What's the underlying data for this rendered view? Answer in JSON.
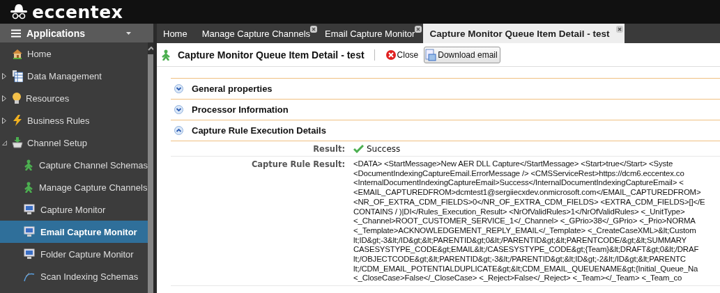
{
  "brand": {
    "name": "eccentex"
  },
  "sidebar": {
    "title": "Applications",
    "items": [
      {
        "label": "Home",
        "kind": "home",
        "selected": false
      },
      {
        "label": "Data Management",
        "kind": "table",
        "selected": false,
        "expanded": false
      },
      {
        "label": "Resources",
        "kind": "bulb",
        "selected": false,
        "expanded": false
      },
      {
        "label": "Business Rules",
        "kind": "bolt",
        "selected": false,
        "expanded": false
      },
      {
        "label": "Channel Setup",
        "kind": "basket",
        "selected": false,
        "expanded": true,
        "children": [
          {
            "label": "Capture Channel Schemas",
            "kind": "person",
            "selected": false
          },
          {
            "label": "Manage Capture Channels",
            "kind": "person",
            "selected": false
          },
          {
            "label": "Capture Monitor",
            "kind": "monitor",
            "selected": false
          },
          {
            "label": "Email Capture Monitor",
            "kind": "monitor",
            "selected": true
          },
          {
            "label": "Folder Capture Monitor",
            "kind": "monitor",
            "selected": false
          },
          {
            "label": "Scan Indexing Schemas",
            "kind": "curve",
            "selected": false
          }
        ]
      }
    ]
  },
  "tabs": [
    {
      "label": "Home",
      "selected": false,
      "closable": false
    },
    {
      "label": "Manage Capture Channels",
      "selected": false,
      "closable": true
    },
    {
      "label": "Email Capture Monitor",
      "selected": false,
      "closable": true
    },
    {
      "label": "Capture Monitor Queue Item Detail - test",
      "selected": true,
      "closable": true
    }
  ],
  "page": {
    "title": "Capture Monitor Queue Item Detail - test",
    "buttons": [
      {
        "label": "Close",
        "kind": "close"
      },
      {
        "label": "Download email",
        "kind": "download"
      }
    ]
  },
  "sections": [
    {
      "title": "General properties",
      "expanded": false
    },
    {
      "title": "Processor Information",
      "expanded": false
    },
    {
      "title": "Capture Rule Execution Details",
      "expanded": true,
      "fields": [
        {
          "label": "Result:",
          "kind": "status",
          "value": "Success"
        },
        {
          "label": "Capture Rule Result:",
          "kind": "text",
          "lines": [
            "<DATA> <StartMessage>New AER DLL Capture</StartMessage> <Start>true</Start> <Syste",
            "<DocumentIndexingCaptureEmail.ErrorMessage /> <CMSServiceRest>https://dcm6.eccentex.co",
            "<InternalDocumentIndexingCaptureEmail>Success</InternalDocumentIndexingCaptureEmail> <",
            "<EMAIL_CAPTUREDFROM>dcmtest1@sergiiecxdev.onmicrosoft.com</EMAIL_CAPTUREDFROM>",
            "<NR_OF_EXTRA_CDM_FIELDS>0</NR_OF_EXTRA_CDM_FIELDS> <EXTRA_CDM_FIELDS>[]</E",
            "CONTAINS / )|DI</Rules_Execution_Result> <NrOfValidRules>1</NrOfValidRules> <_UnitType>",
            "<_Channel>ROOT_CUSTOMER_SERVICE_1</_Channel> <_GPrio>38</_GPrio> <_Prio>NORMA",
            "<_Template>ACKNOWLEDGEMENT_REPLY_EMAIL</_Template> <_CreateCaseXML>&lt;Custom",
            "lt;ID&gt;-3&lt;/ID&gt;&lt;PARENTID&gt;0&lt;/PARENTID&gt;&lt;PARENTCODE/&gt;&lt;SUMMARY",
            "CASESYSTYPE_CODE&gt;EMAIL&lt;/CASESYSTYPE_CODE&gt;{Team}&lt;DRAFT&gt;0&lt;/DRAF",
            "lt;/OBJECTCODE&gt;&lt;PARENTID&gt;-3&lt;/PARENTID&gt;&lt;ID&gt;-2&lt;/ID&gt;&lt;PARENTC",
            "lt;/CDM_EMAIL_POTENTIALDUPLICATE&gt;&lt;CDM_EMAIL_QUEUENAME&gt;{Initial_Queue_Na",
            "<_CloseCase>False</_CloseCase> <_Reject>False</_Reject> <_Team></_Team> <_Team_co"
          ]
        }
      ]
    }
  ]
}
